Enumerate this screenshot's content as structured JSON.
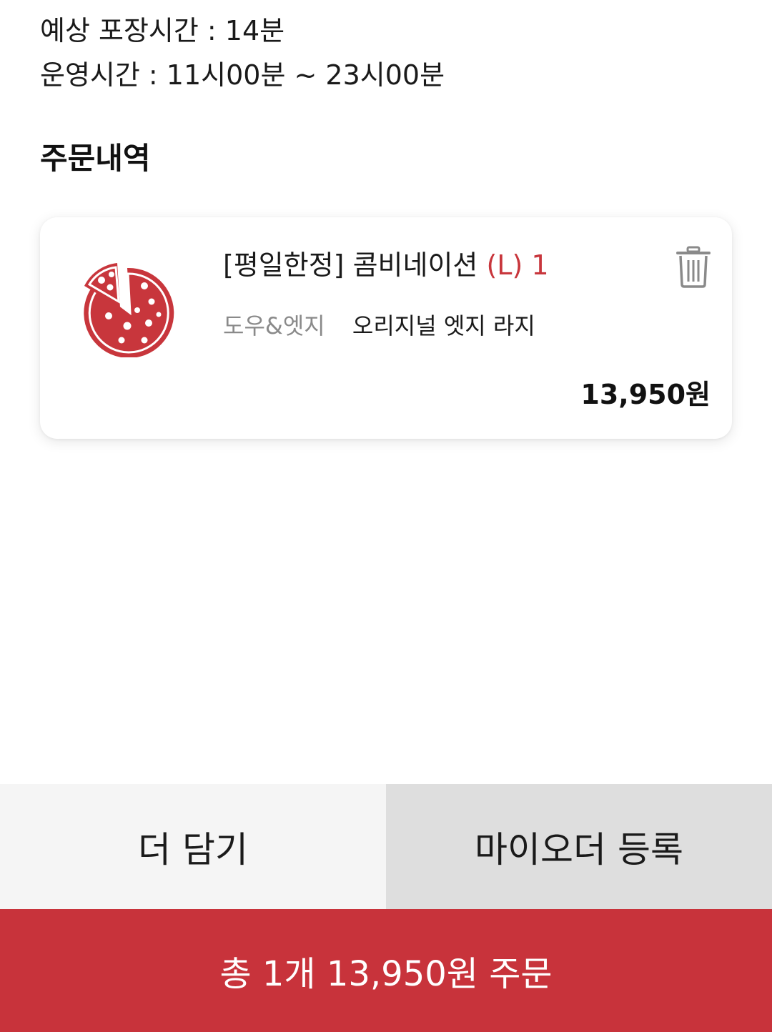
{
  "store_info": {
    "packing_time": "예상 포장시간 : 14분",
    "operating_hours": "운영시간 : 11시00분 ~ 23시00분"
  },
  "order_section": {
    "title": "주문내역"
  },
  "order_item": {
    "name": "[평일한정] 콤비네이션",
    "size": "(L)",
    "quantity": "1",
    "option_label": "도우&엣지",
    "option_value": "오리지널 엣지 라지",
    "price": "13,950원",
    "icon": "pizza-icon"
  },
  "buttons": {
    "add_more": "더 담기",
    "register_my_order": "마이오더 등록",
    "order": "총 1개 13,950원 주문"
  },
  "colors": {
    "accent": "#c8333b",
    "secondary_button": "#dedede",
    "tertiary_button": "#f5f5f5"
  }
}
